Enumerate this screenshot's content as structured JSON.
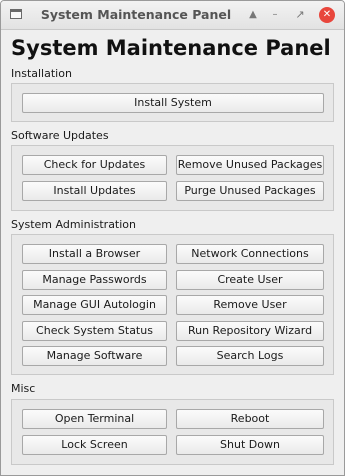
{
  "window": {
    "title": "System Maintenance Panel",
    "controls": [
      "keep-above-icon",
      "minimize-icon",
      "maximize-icon",
      "close-icon"
    ]
  },
  "heading": "System Maintenance Panel",
  "sections": {
    "installation": {
      "label": "Installation",
      "buttons": [
        "Install System"
      ]
    },
    "software_updates": {
      "label": "Software Updates",
      "buttons": [
        "Check for Updates",
        "Remove Unused Packages",
        "Install Updates",
        "Purge Unused Packages"
      ]
    },
    "system_administration": {
      "label": "System Administration",
      "buttons": [
        "Install a Browser",
        "Network Connections",
        "Manage Passwords",
        "Create User",
        "Manage GUI Autologin",
        "Remove User",
        "Check System Status",
        "Run Repository Wizard",
        "Manage Software",
        "Search Logs"
      ]
    },
    "misc": {
      "label": "Misc",
      "buttons": [
        "Open Terminal",
        "Reboot",
        "Lock Screen",
        "Shut Down"
      ]
    }
  },
  "colors": {
    "close_button": "#e8463c",
    "window_background": "#efefef",
    "group_background": "#e8e8e8"
  }
}
